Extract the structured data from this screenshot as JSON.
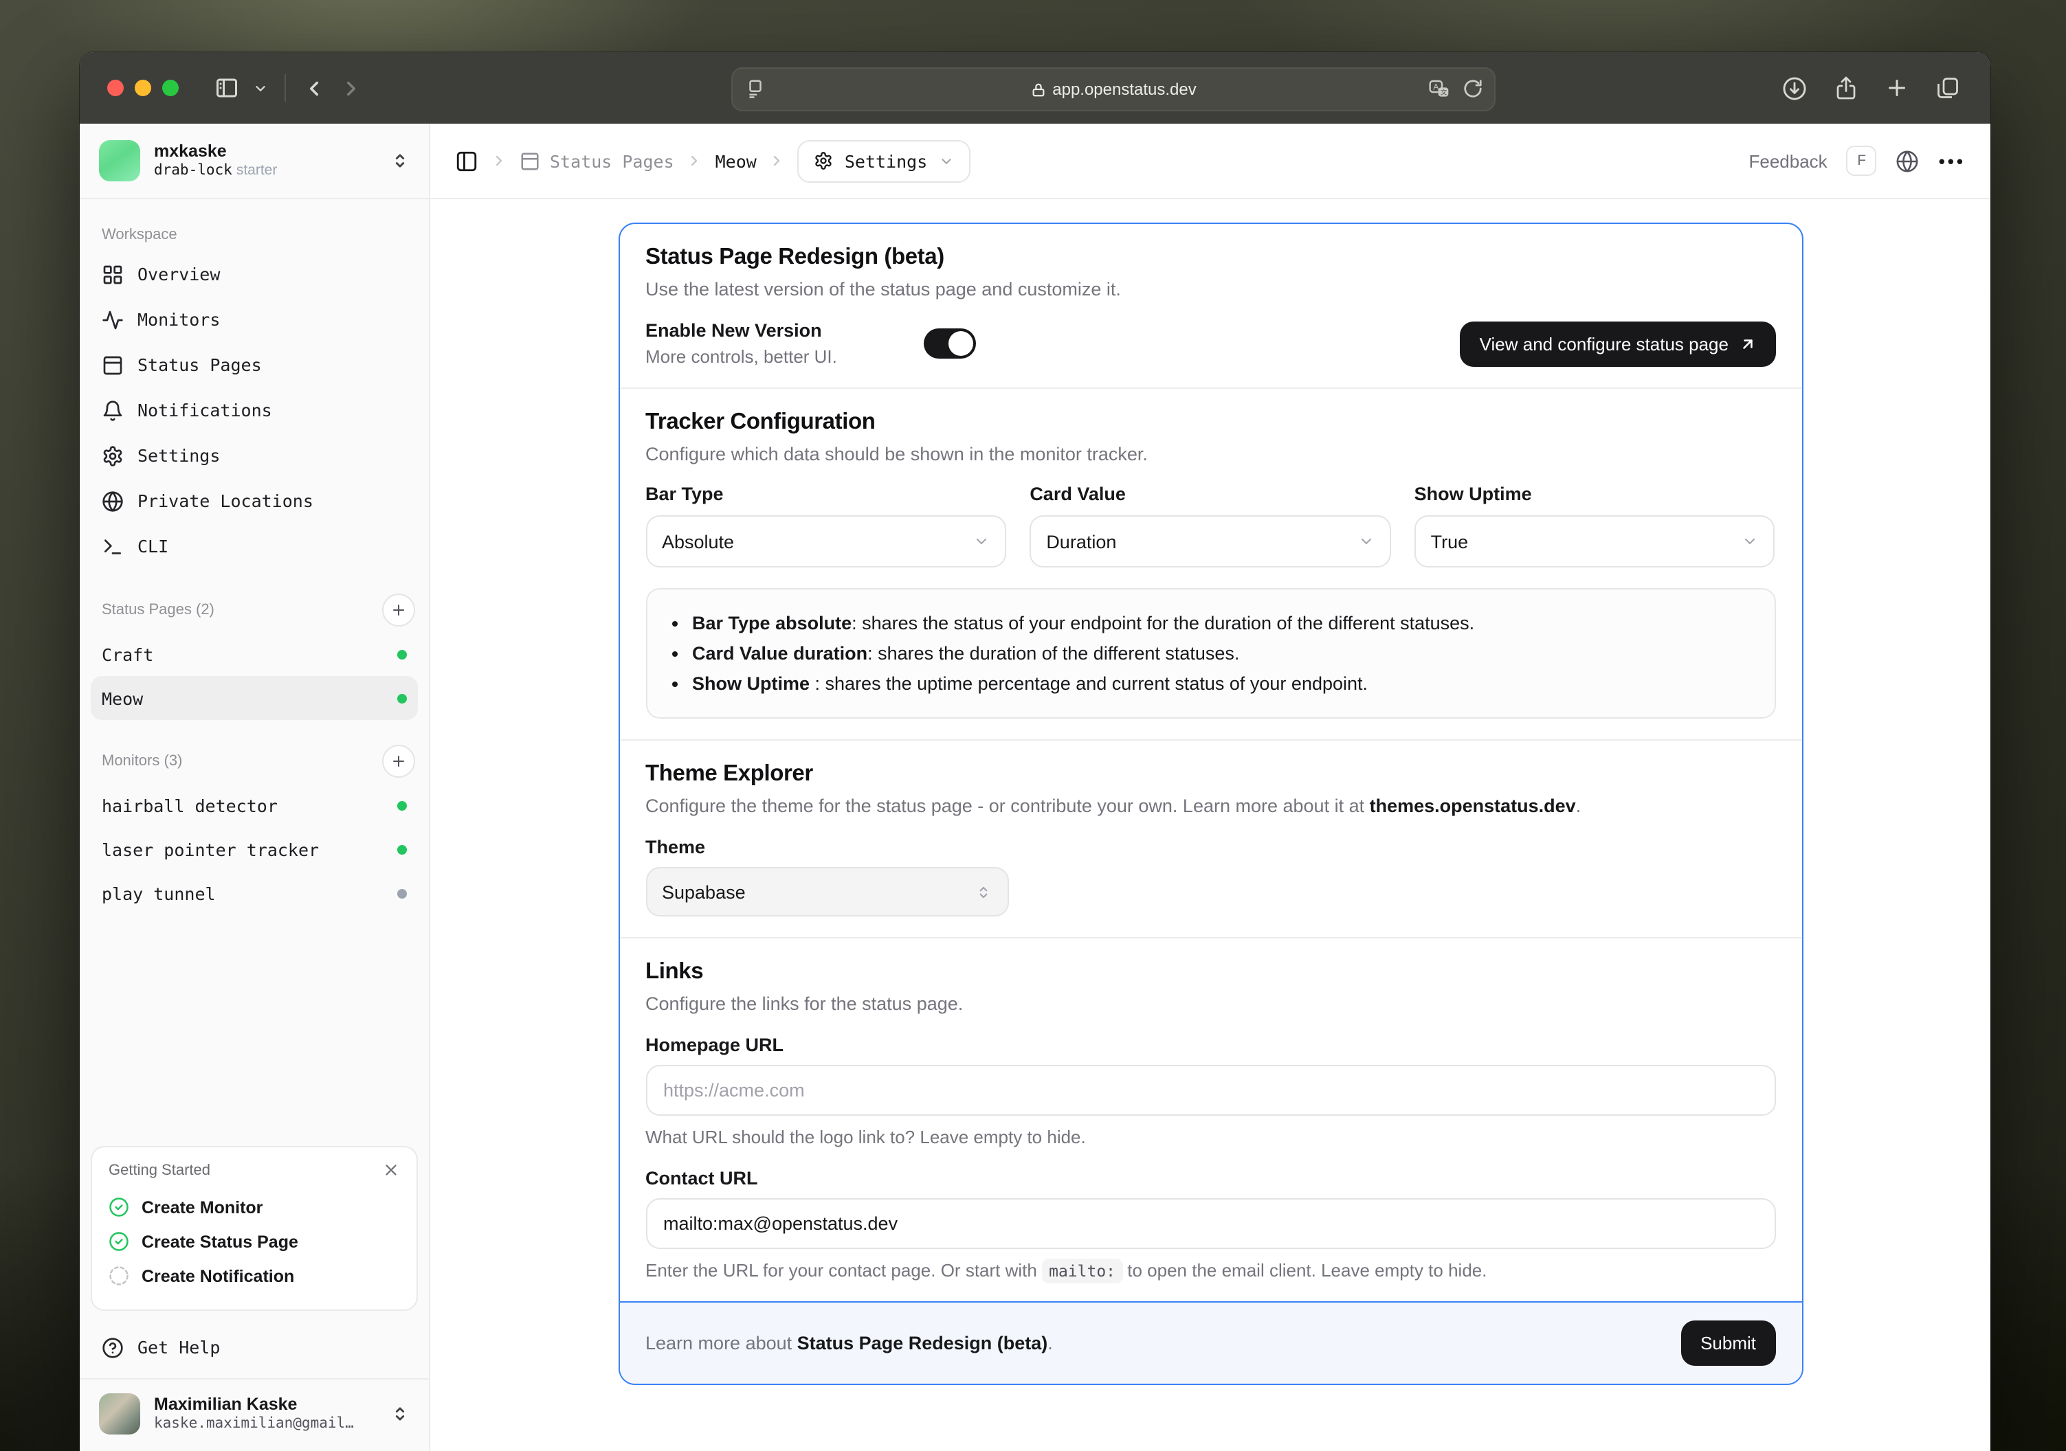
{
  "colors": {
    "accent_blue": "#3b82f6",
    "status_up": "#22c55e",
    "status_inactive": "#9ca3af",
    "button_dark": "#18181b"
  },
  "browser": {
    "url": "app.openstatus.dev"
  },
  "sidebar": {
    "workspace": {
      "name": "mxkaske",
      "team": "drab-lock",
      "tier": "starter"
    },
    "section_workspace": "Workspace",
    "nav": [
      {
        "label": "Overview"
      },
      {
        "label": "Monitors"
      },
      {
        "label": "Status Pages"
      },
      {
        "label": "Notifications"
      },
      {
        "label": "Settings"
      },
      {
        "label": "Private Locations"
      },
      {
        "label": "CLI"
      }
    ],
    "status_pages": {
      "label": "Status Pages",
      "count": "(2)",
      "items": [
        {
          "name": "Craft"
        },
        {
          "name": "Meow"
        }
      ]
    },
    "monitors": {
      "label": "Monitors",
      "count": "(3)",
      "items": [
        {
          "name": "hairball detector"
        },
        {
          "name": "laser pointer tracker"
        },
        {
          "name": "play tunnel"
        }
      ]
    },
    "getting_started": {
      "title": "Getting Started",
      "items": [
        {
          "label": "Create Monitor"
        },
        {
          "label": "Create Status Page"
        },
        {
          "label": "Create Notification"
        }
      ]
    },
    "get_help": "Get Help",
    "user": {
      "name": "Maximilian Kaske",
      "email": "kaske.maximilian@gmail…"
    }
  },
  "header": {
    "breadcrumb_root": "Status Pages",
    "breadcrumb_page": "Meow",
    "settings_label": "Settings",
    "feedback_label": "Feedback",
    "feedback_key": "F"
  },
  "main": {
    "redesign": {
      "title": "Status Page Redesign (beta)",
      "desc": "Use the latest version of the status page and customize it.",
      "toggle_label": "Enable New Version",
      "toggle_sub": "More controls, better UI.",
      "cta": "View and configure status page"
    },
    "tracker": {
      "title": "Tracker Configuration",
      "desc": "Configure which data should be shown in the monitor tracker.",
      "fields": [
        {
          "label": "Bar Type",
          "value": "Absolute"
        },
        {
          "label": "Card Value",
          "value": "Duration"
        },
        {
          "label": "Show Uptime",
          "value": "True"
        }
      ],
      "bullets": [
        {
          "prefix": "Bar Type ",
          "keyword": "absolute",
          "rest": ": shares the status of your endpoint for the duration of the different statuses."
        },
        {
          "prefix": "Card Value ",
          "keyword": "duration",
          "rest": ": shares the duration of the different statuses."
        },
        {
          "prefix": "Show Uptime",
          "keyword": "",
          "rest": " : shares the uptime percentage and current status of your endpoint."
        }
      ]
    },
    "theme": {
      "title": "Theme Explorer",
      "desc_prefix": "Configure the theme for the status page - or contribute your own. Learn more about it at ",
      "desc_link": "themes.openstatus.dev",
      "desc_suffix": ".",
      "field_label": "Theme",
      "value": "Supabase"
    },
    "links": {
      "title": "Links",
      "desc": "Configure the links for the status page.",
      "homepage": {
        "label": "Homepage URL",
        "placeholder": "https://acme.com",
        "helper": "What URL should the logo link to? Leave empty to hide."
      },
      "contact": {
        "label": "Contact URL",
        "value": "mailto:max@openstatus.dev",
        "helper_prefix": "Enter the URL for your contact page. Or start with ",
        "helper_code": "mailto:",
        "helper_suffix": " to open the email client. Leave empty to hide."
      }
    },
    "footer": {
      "prefix": "Learn more about ",
      "bold": "Status Page Redesign (beta)",
      "suffix": ".",
      "submit": "Submit"
    }
  }
}
